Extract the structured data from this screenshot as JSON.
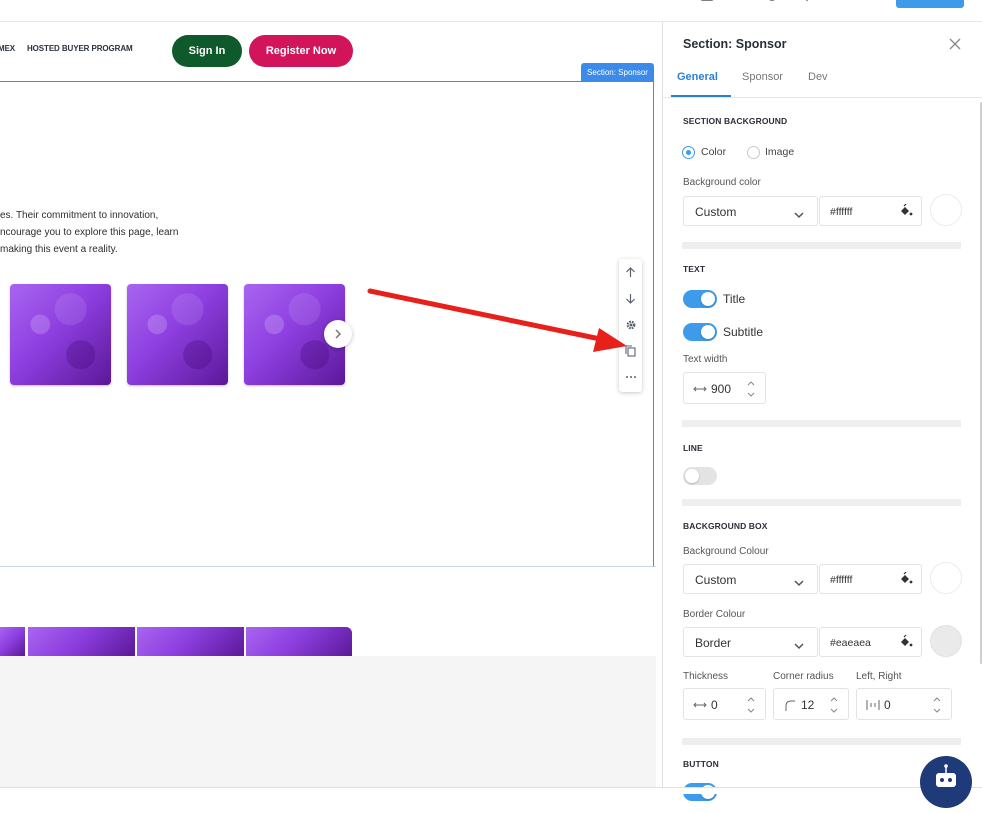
{
  "canvas": {
    "nav_links": [
      "MEX",
      "HOSTED BUYER PROGRAM"
    ],
    "sign_in_label": "Sign In",
    "register_label": "Register Now",
    "section_tag": "Section: Sponsor",
    "sponsor_text_lines": [
      "es. Their commitment to innovation,",
      "ncourage you to explore this page, learn",
      "making this event a reality."
    ],
    "colors": {
      "sign_in": "#0e5a2c",
      "register": "#d2145a",
      "selection": "#3d8be8",
      "arrow": "#e8201a"
    }
  },
  "panel": {
    "title": "Section: Sponsor",
    "tabs": [
      "General",
      "Sponsor",
      "Dev"
    ],
    "active_tab": "General",
    "section_background": {
      "heading": "SECTION BACKGROUND",
      "options": [
        "Color",
        "Image"
      ],
      "selected": "Color",
      "bg_color_label": "Background color",
      "bg_mode": "Custom",
      "bg_hex": "#ffffff"
    },
    "text": {
      "heading": "TEXT",
      "toggles": [
        {
          "label": "Title",
          "on": true
        },
        {
          "label": "Subtitle",
          "on": true
        }
      ],
      "width_label": "Text width",
      "width_value": "900"
    },
    "line": {
      "heading": "LINE",
      "on": false
    },
    "background_box": {
      "heading": "BACKGROUND BOX",
      "bg_colour_label": "Background Colour",
      "bg_mode": "Custom",
      "bg_hex": "#ffffff",
      "border_colour_label": "Border Colour",
      "border_mode": "Border",
      "border_hex": "#eaeaea",
      "thickness_label": "Thickness",
      "thickness_value": "0",
      "radius_label": "Corner radius",
      "radius_value": "12",
      "lr_label": "Left, Right",
      "lr_value": "0"
    },
    "button": {
      "heading": "BUTTON"
    },
    "colors": {
      "accent": "#3d9be9",
      "border_swatch": "#eaeaea"
    }
  }
}
